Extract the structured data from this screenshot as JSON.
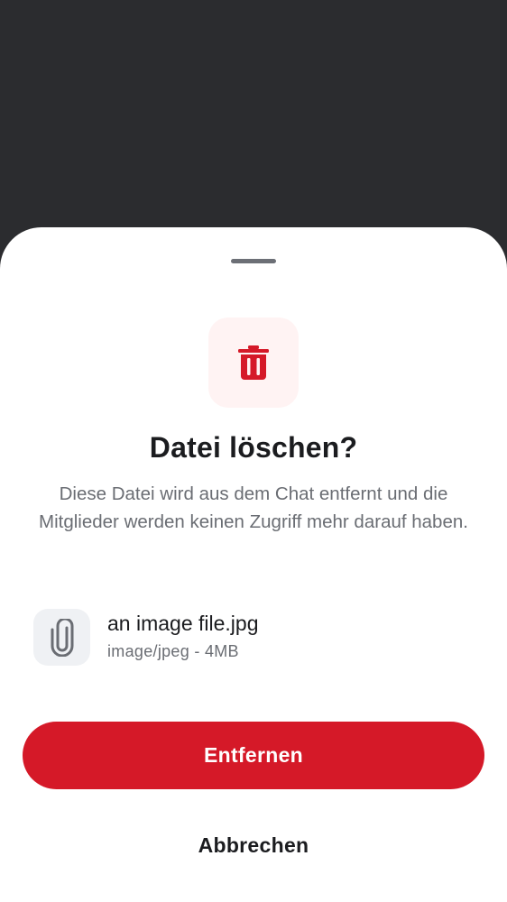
{
  "dialog": {
    "title": "Datei löschen?",
    "description": "Diese Datei wird aus dem Chat entfernt und die Mitglieder werden keinen Zugriff mehr darauf haben.",
    "icon": "trash-icon",
    "icon_color": "#d51928",
    "icon_background": "#fff3f3"
  },
  "file": {
    "name": "an image file.jpg",
    "meta": "image/jpeg - 4MB",
    "icon": "paperclip-icon"
  },
  "actions": {
    "confirm_label": "Entfernen",
    "confirm_color": "#d51928",
    "cancel_label": "Abbrechen"
  }
}
